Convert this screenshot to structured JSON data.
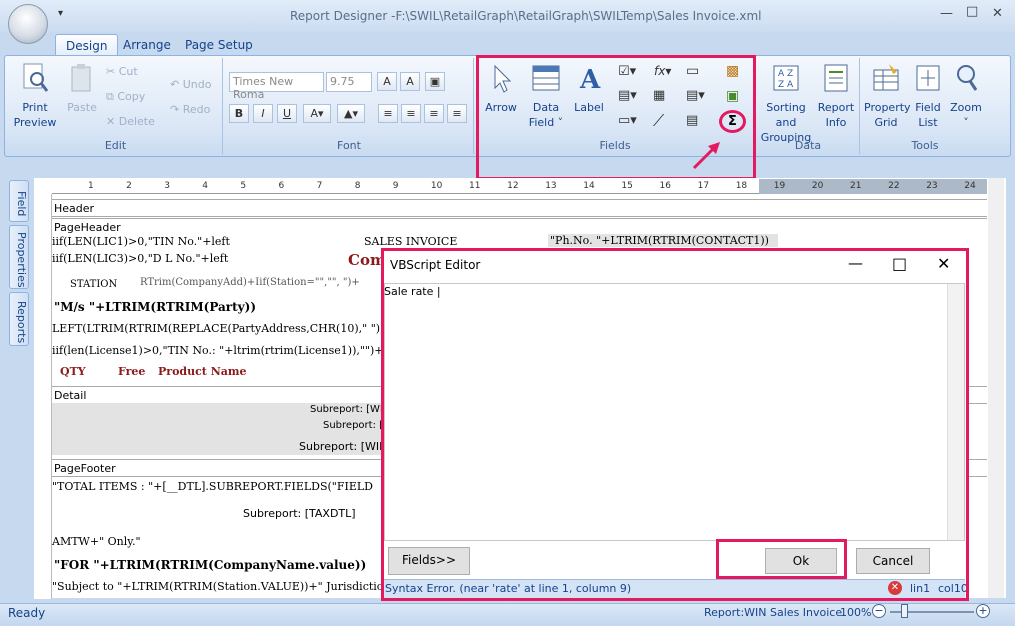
{
  "window": {
    "title": "Report Designer -F:\\SWIL\\RetailGraph\\RetailGraph\\SWILTemp\\Sales Invoice.xml",
    "qat": "▾"
  },
  "tabs": [
    {
      "label": "Design",
      "active": true
    },
    {
      "label": "Arrange"
    },
    {
      "label": "Page Setup"
    }
  ],
  "ribbon": {
    "print_preview": {
      "line1": "Print",
      "line2": "Preview"
    },
    "paste": "Paste",
    "cut": "Cut",
    "copy": "Copy",
    "delete": "Delete",
    "undo": "Undo",
    "redo": "Redo",
    "edit_group": "Edit",
    "font_name": "Times New Roma",
    "font_size": "9.75",
    "font_group": "Font",
    "arrow": "Arrow",
    "data_field": {
      "line1": "Data",
      "line2": "Field ˅"
    },
    "label": "Label",
    "fields_group": "Fields",
    "sorting": {
      "line1": "Sorting and",
      "line2": "Grouping"
    },
    "report_info": {
      "line1": "Report",
      "line2": "Info"
    },
    "data_group": "Data",
    "property_grid": {
      "line1": "Property",
      "line2": "Grid"
    },
    "field_list": {
      "line1": "Field",
      "line2": "List"
    },
    "zoom": {
      "line1": "Zoom",
      "line2": "˅"
    },
    "tools_group": "Tools"
  },
  "side_tabs": [
    "Field",
    "Properties",
    "Reports"
  ],
  "ruler": [
    "1",
    "2",
    "3",
    "4",
    "5",
    "6",
    "7",
    "8",
    "9",
    "10",
    "11",
    "12",
    "13",
    "14",
    "15",
    "16",
    "17",
    "18",
    "19",
    "20",
    "21",
    "22",
    "23",
    "24"
  ],
  "report": {
    "header_band": "Header",
    "pageheader_band": "PageHeader",
    "lines": {
      "tin": "iif(LEN(LIC1)>0,\"TIN  No.\"+left",
      "sales_invoice": "SALES INVOICE",
      "ph": "\"Ph.No. \"+LTRIM(RTRIM(CONTACT1))",
      "dl": "iif(LEN(LIC3)>0,\"D L No.\"+left",
      "com": "Com",
      "station": "STATION",
      "rtrim": "RTrim(CompanyAdd)+Iif(Station=\"\",\"\", \")+",
      "ms": "\"M/s \"+LTRIM(RTRIM(Party))",
      "left": "LEFT(LTRIM(RTRIM(REPLACE(PartyAddress,CHR(10),\" \"))",
      "license": "iif(len(License1)>0,\"TIN No.: \"+ltrim(rtrim(License1)),\"\")+iif",
      "qty": "QTY",
      "free": "Free",
      "product": "Product Name"
    },
    "detail_band": "Detail",
    "sub1": "Subreport: [WI",
    "sub2": "Subreport: [",
    "sub3": "Subreport: [WIN",
    "pagefooter_band": "PageFooter",
    "total": "\"TOTAL ITEMS : \"+[__DTL].SUBREPORT.FIELDS(\"FIELD",
    "taxdtl": "Subreport: [TAXDTL]",
    "amtw": "AMTW+\" Only.\"",
    "for": "\"FOR \"+LTRIM(RTRIM(CompanyName.value))",
    "subject": "\"Subject to \"+LTRIM(RTRIM(Station.VALUE))+\" Jurisdiction"
  },
  "dialog": {
    "title": "VBScript Editor",
    "text": "Sale rate",
    "fields_button": "Fields>>",
    "ok_button": "Ok",
    "cancel_button": "Cancel",
    "status": "Syntax Error. (near 'rate' at line 1, column 9)",
    "line": "lin1",
    "col": "col10"
  },
  "statusbar": {
    "ready": "Ready",
    "report": "Report:WIN Sales Invoice",
    "zoom": "100%"
  },
  "colors": {
    "highlight": "#e5195f",
    "ribbon_text": "#15428b"
  }
}
